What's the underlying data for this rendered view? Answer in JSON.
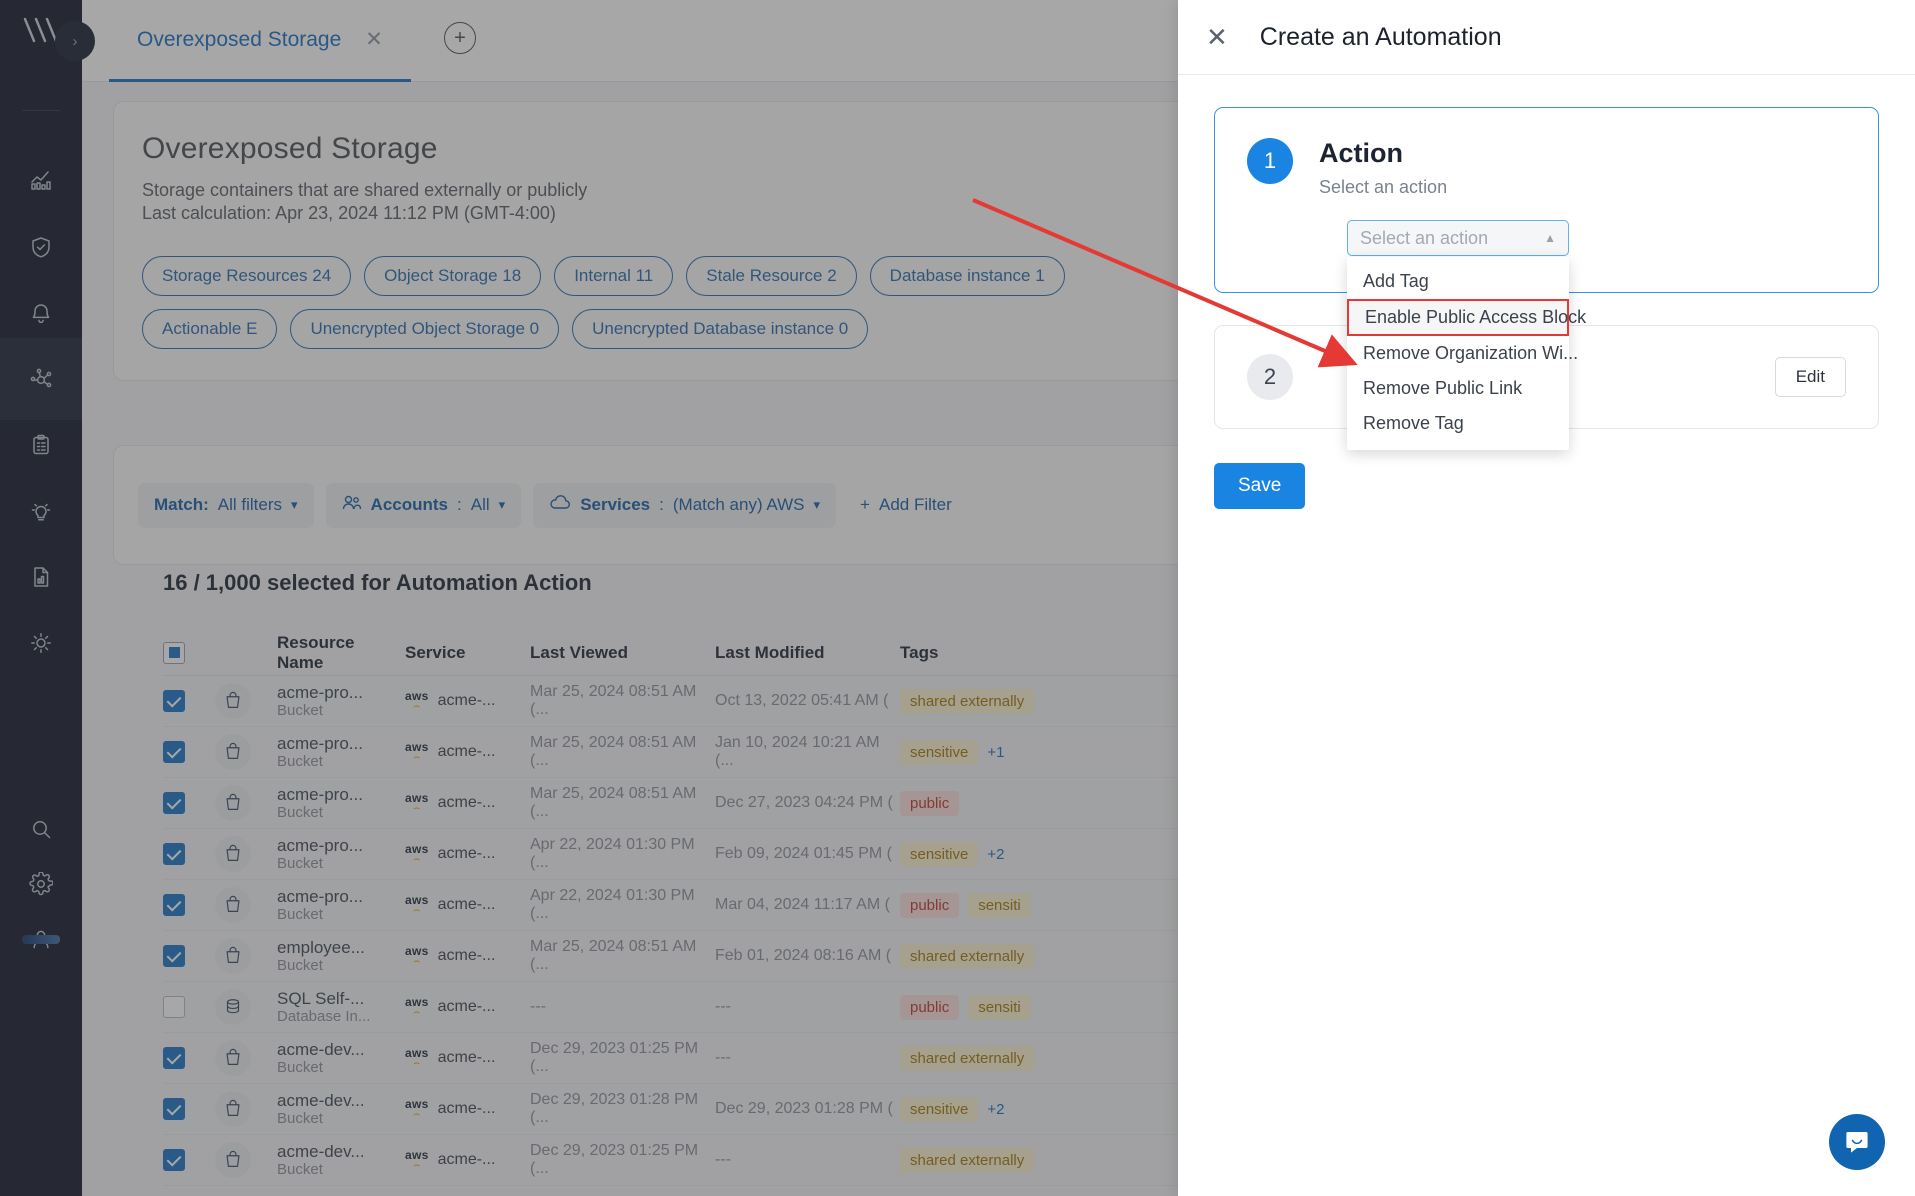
{
  "tab": {
    "label": "Overexposed Storage",
    "close_icon": "close-icon",
    "add_icon": "plus-icon"
  },
  "sidebar": {
    "expand_icon": "chevron-right-icon",
    "items": [
      {
        "icon": "analytics-chart-icon",
        "active": false
      },
      {
        "icon": "shield-check-icon",
        "active": false
      },
      {
        "icon": "bell-icon",
        "active": false
      },
      {
        "icon": "network-graph-icon",
        "active": true
      },
      {
        "icon": "clipboard-list-icon",
        "active": false
      },
      {
        "icon": "lightbulb-icon",
        "active": false
      },
      {
        "icon": "report-document-icon",
        "active": false
      },
      {
        "icon": "sun-icon",
        "active": false
      },
      {
        "icon": "search-icon",
        "active": false
      },
      {
        "icon": "gear-icon",
        "active": false
      },
      {
        "icon": "user-icon",
        "active": false
      }
    ]
  },
  "page": {
    "title": "Overexposed Storage",
    "subtitle": "Storage containers that are shared externally or publicly",
    "last_calculation": "Last calculation: Apr 23, 2024 11:12 PM (GMT-4:00)",
    "chips": [
      "Storage Resources 24",
      "Object Storage 18",
      "Internal 11",
      "Stale Resource 2",
      "Database instance 1",
      "Actionable E",
      "Unencrypted Object Storage 0",
      "Unencrypted Database instance 0"
    ]
  },
  "filters": {
    "match": {
      "label": "Match:",
      "value": "All filters"
    },
    "accounts": {
      "icon": "people-icon",
      "label": "Accounts",
      "value": "All"
    },
    "services": {
      "icon": "cloud-icon",
      "label": "Services",
      "value": "(Match any) AWS"
    },
    "add_filter": {
      "icon": "plus-icon",
      "label": "Add Filter"
    }
  },
  "table": {
    "selection_text": "16 / 1,000 selected for Automation Action",
    "columns": [
      "Resource Name",
      "Service",
      "Last Viewed",
      "Last Modified",
      "Tags"
    ],
    "header_checkbox": "indeterminate",
    "rows": [
      {
        "checked": true,
        "icon": "bucket-icon",
        "name": "acme-pro...",
        "type": "Bucket",
        "service": "acme-...",
        "last_viewed": "Mar 25, 2024 08:51 AM (...",
        "last_modified": "Oct 13, 2022 05:41 AM (",
        "tags": [
          {
            "text": "shared externally",
            "color": "yellow"
          }
        ],
        "more": ""
      },
      {
        "checked": true,
        "icon": "bucket-icon",
        "name": "acme-pro...",
        "type": "Bucket",
        "service": "acme-...",
        "last_viewed": "Mar 25, 2024 08:51 AM (...",
        "last_modified": "Jan 10, 2024 10:21 AM (...",
        "tags": [
          {
            "text": "sensitive",
            "color": "yellow"
          }
        ],
        "more": "+1"
      },
      {
        "checked": true,
        "icon": "bucket-icon",
        "name": "acme-pro...",
        "type": "Bucket",
        "service": "acme-...",
        "last_viewed": "Mar 25, 2024 08:51 AM (...",
        "last_modified": "Dec 27, 2023 04:24 PM (",
        "tags": [
          {
            "text": "public",
            "color": "red"
          }
        ],
        "more": ""
      },
      {
        "checked": true,
        "icon": "bucket-icon",
        "name": "acme-pro...",
        "type": "Bucket",
        "service": "acme-...",
        "last_viewed": "Apr 22, 2024 01:30 PM (...",
        "last_modified": "Feb 09, 2024 01:45 PM (",
        "tags": [
          {
            "text": "sensitive",
            "color": "yellow"
          }
        ],
        "more": "+2"
      },
      {
        "checked": true,
        "icon": "bucket-icon",
        "name": "acme-pro...",
        "type": "Bucket",
        "service": "acme-...",
        "last_viewed": "Apr 22, 2024 01:30 PM (...",
        "last_modified": "Mar 04, 2024 11:17 AM (",
        "tags": [
          {
            "text": "public",
            "color": "red"
          },
          {
            "text": "sensiti",
            "color": "yellow"
          }
        ],
        "more": ""
      },
      {
        "checked": true,
        "icon": "bucket-icon",
        "name": "employee...",
        "type": "Bucket",
        "service": "acme-...",
        "last_viewed": "Mar 25, 2024 08:51 AM (...",
        "last_modified": "Feb 01, 2024 08:16 AM (",
        "tags": [
          {
            "text": "shared externally",
            "color": "yellow"
          }
        ],
        "more": ""
      },
      {
        "checked": false,
        "icon": "database-icon",
        "name": "SQL Self-...",
        "type": "Database In...",
        "service": "acme-...",
        "last_viewed": "---",
        "last_modified": "---",
        "tags": [
          {
            "text": "public",
            "color": "red"
          },
          {
            "text": "sensiti",
            "color": "yellow"
          }
        ],
        "more": ""
      },
      {
        "checked": true,
        "icon": "bucket-icon",
        "name": "acme-dev...",
        "type": "Bucket",
        "service": "acme-...",
        "last_viewed": "Dec 29, 2023 01:25 PM (...",
        "last_modified": "---",
        "tags": [
          {
            "text": "shared externally",
            "color": "yellow"
          }
        ],
        "more": ""
      },
      {
        "checked": true,
        "icon": "bucket-icon",
        "name": "acme-dev...",
        "type": "Bucket",
        "service": "acme-...",
        "last_viewed": "Dec 29, 2023 01:28 PM (...",
        "last_modified": "Dec 29, 2023 01:28 PM (",
        "tags": [
          {
            "text": "sensitive",
            "color": "yellow"
          }
        ],
        "more": "+2"
      },
      {
        "checked": true,
        "icon": "bucket-icon",
        "name": "acme-dev...",
        "type": "Bucket",
        "service": "acme-...",
        "last_viewed": "Dec 29, 2023 01:25 PM (...",
        "last_modified": "---",
        "tags": [
          {
            "text": "shared externally",
            "color": "yellow"
          }
        ],
        "more": ""
      }
    ]
  },
  "drawer": {
    "close_icon": "close-icon",
    "title": "Create an Automation",
    "step1": {
      "number": "1",
      "heading": "Action",
      "subheading": "Select an action",
      "select_placeholder": "Select an action",
      "select_value": "",
      "chevron_icon": "chevron-up-icon",
      "options": [
        {
          "label": "Add Tag",
          "highlighted": false
        },
        {
          "label": "Enable Public Access Block",
          "highlighted": true
        },
        {
          "label": "Remove Organization Wi...",
          "highlighted": false
        },
        {
          "label": "Remove Public Link",
          "highlighted": false
        },
        {
          "label": "Remove Tag",
          "highlighted": false
        }
      ]
    },
    "step2": {
      "number": "2",
      "edit_label": "Edit"
    },
    "save_label": "Save"
  },
  "chat": {
    "icon": "chat-bubble-icon"
  },
  "colors": {
    "accent": "#1a84e2",
    "link": "#1a6fc4",
    "rail": "#151b2c",
    "annotation": "#e53935"
  }
}
